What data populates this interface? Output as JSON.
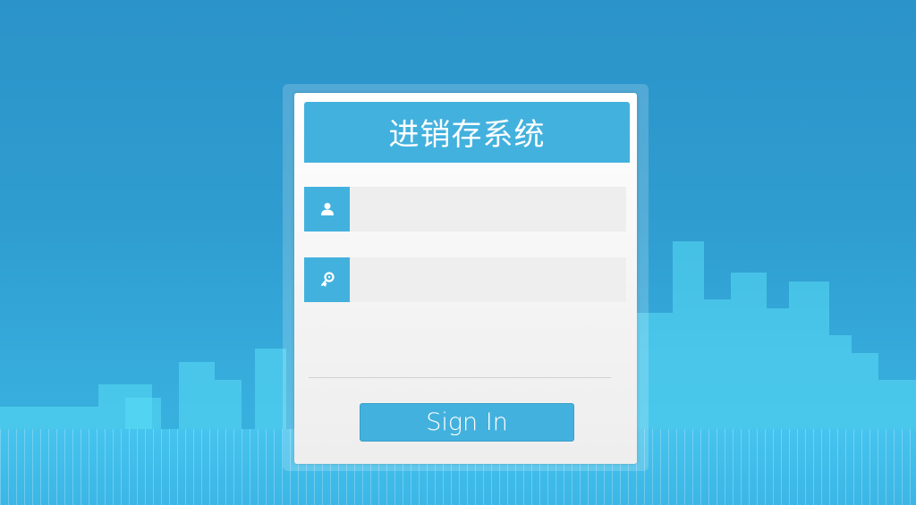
{
  "app": {
    "title": "进销存系统"
  },
  "login": {
    "username": {
      "value": "",
      "icon": "user-icon"
    },
    "password": {
      "value": "",
      "icon": "key-icon"
    },
    "submit_label": "Sign In"
  },
  "colors": {
    "accent": "#43b1de",
    "background": "#2f9dd0",
    "input_background": "#eeeeee"
  }
}
